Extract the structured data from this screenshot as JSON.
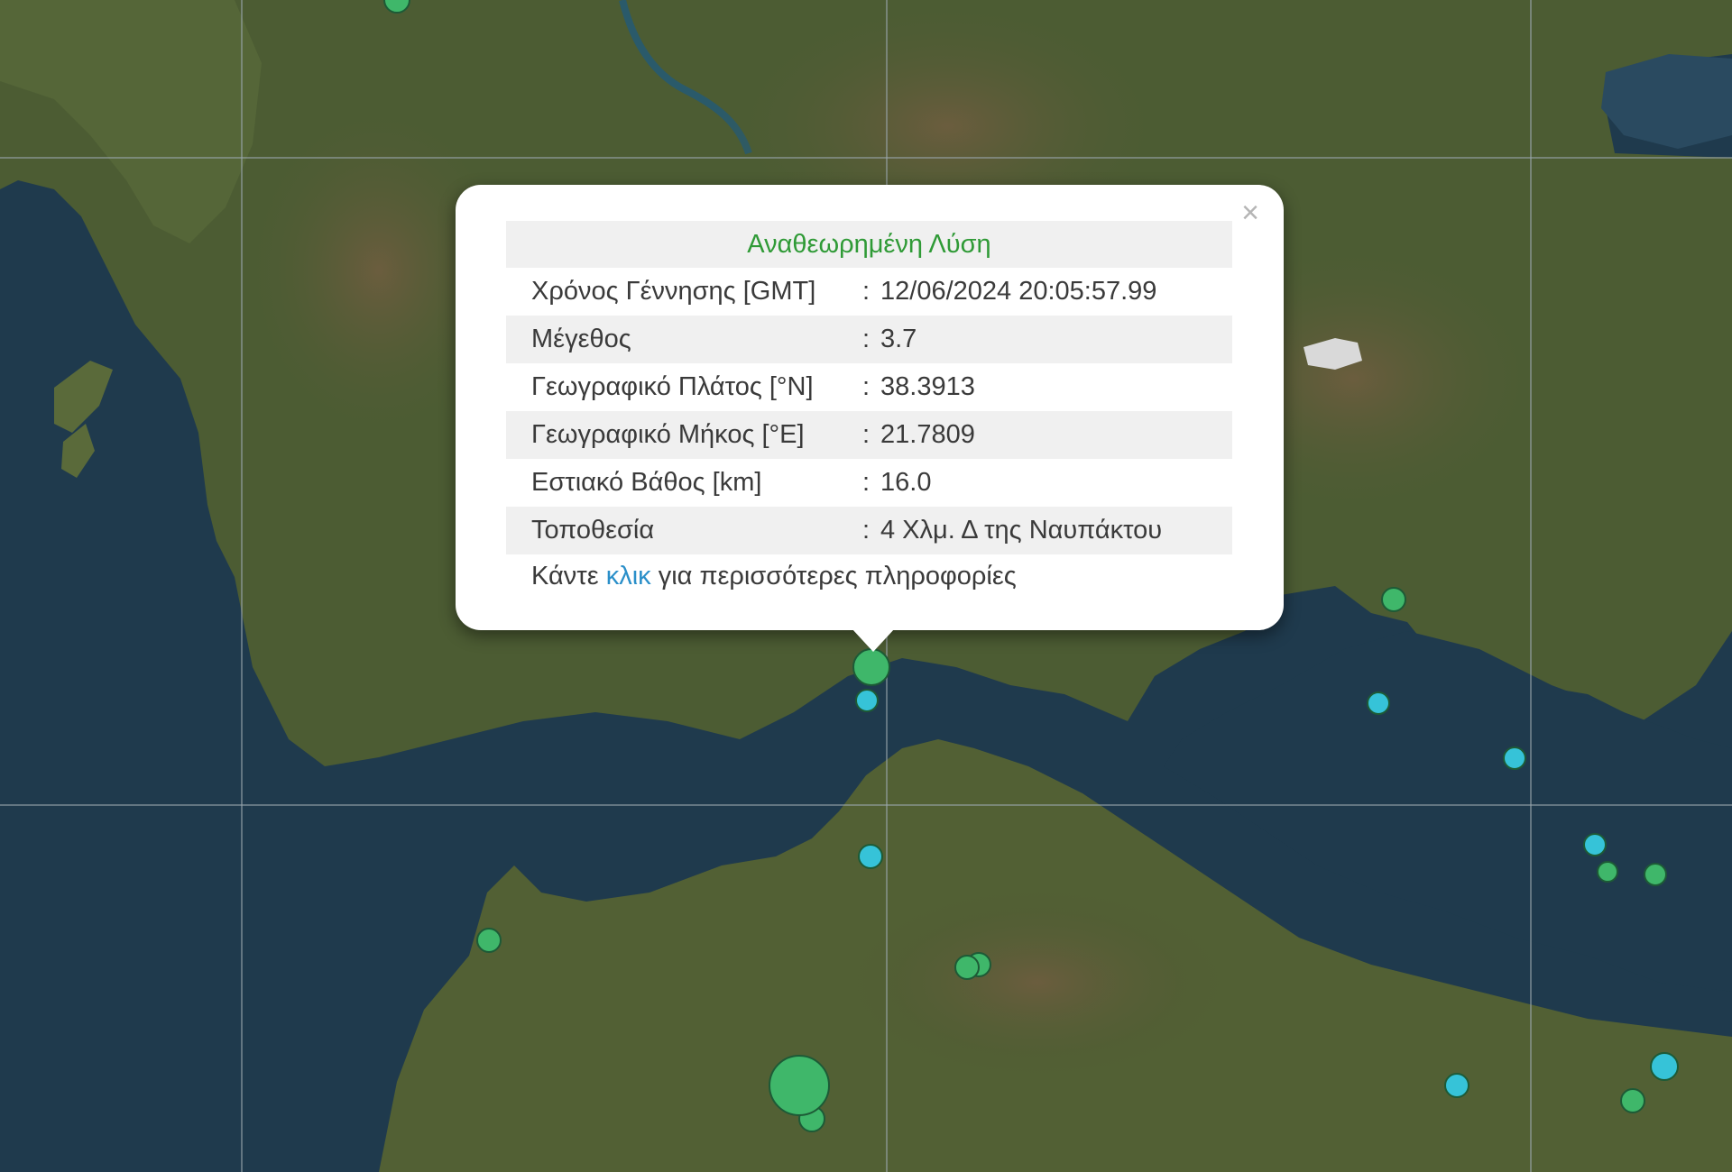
{
  "popup": {
    "title": "Αναθεωρημένη Λύση",
    "close_icon": "×",
    "rows": [
      {
        "label": "Χρόνος Γέννησης [GMT]",
        "value": "12/06/2024 20:05:57.99"
      },
      {
        "label": "Μέγεθος",
        "value": "3.7"
      },
      {
        "label": "Γεωγραφικό Πλάτος [°N]",
        "value": "38.3913"
      },
      {
        "label": "Γεωγραφικό Μήκος [°E]",
        "value": "21.7809"
      },
      {
        "label": "Εστιακό Βάθος [km]",
        "value": "16.0"
      },
      {
        "label": "Τοποθεσία",
        "value": "4 Χλμ. Δ της Ναυπάκτου"
      }
    ],
    "separator": ":",
    "more_prefix": "Κάντε ",
    "more_link": "κλικ",
    "more_suffix": " για περισσότερες πληροφορίες"
  },
  "colors": {
    "sea": "#1f3a4d",
    "land": "#4a5a32",
    "marker_green": "#3fb76a",
    "marker_cyan": "#36c3d8",
    "title_green": "#2f9a36",
    "link_blue": "#2a8fc9"
  }
}
